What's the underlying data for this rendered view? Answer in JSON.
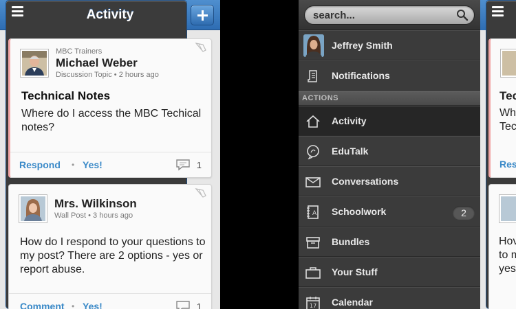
{
  "feed": {
    "title": "Activity",
    "posts": [
      {
        "group": "MBC Trainers",
        "author": "Michael Weber",
        "type": "Discussion Topic",
        "time": "2 hours ago",
        "title": "Technical Notes",
        "body": "Where do I access the MBC Techical notes?",
        "action1": "Respond",
        "action2": "Yes!",
        "comments": "1"
      },
      {
        "author": "Mrs. Wilkinson",
        "type": "Wall Post",
        "time": "3 hours ago",
        "body": "How do I respond to your questions to my post?  There are 2 options - yes or report abuse.",
        "action1": "Comment",
        "action2": "Yes!",
        "comments": "1"
      }
    ]
  },
  "menu": {
    "search_placeholder": "search...",
    "user": "Jeffrey  Smith",
    "notifications": "Notifications",
    "section": "ACTIONS",
    "items": [
      {
        "label": "Activity",
        "icon": "home-icon",
        "active": true
      },
      {
        "label": "EduTalk",
        "icon": "edutalk-icon"
      },
      {
        "label": "Conversations",
        "icon": "envelope-icon"
      },
      {
        "label": "Schoolwork",
        "icon": "schoolwork-icon",
        "badge": "2"
      },
      {
        "label": "Bundles",
        "icon": "box-icon"
      },
      {
        "label": "Your Stuff",
        "icon": "briefcase-icon"
      },
      {
        "label": "Calendar",
        "icon": "calendar-icon"
      }
    ]
  },
  "partial": {
    "line1": "Tec",
    "line2": "Wh",
    "line3": "Tec",
    "line4": "Res",
    "line5": "Hov",
    "line6": "to m",
    "line7": "yes"
  },
  "colors": {
    "nav_blue": "#2e6db3",
    "link_blue": "#3b8ac8",
    "menu_bg": "#3b3b3b",
    "accent_pink": "#f1a5a5"
  }
}
